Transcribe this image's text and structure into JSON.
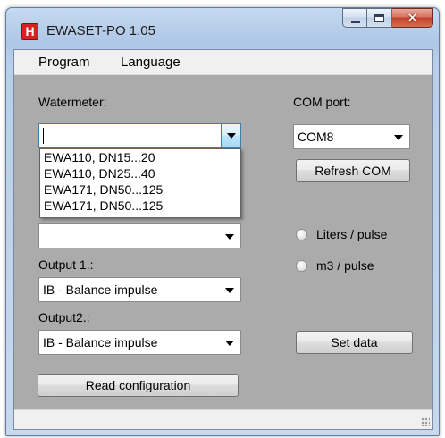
{
  "window": {
    "title": "EWASET-PO 1.05",
    "app_icon_letter": "H"
  },
  "menu": {
    "items": [
      "Program",
      "Language"
    ]
  },
  "watermeter": {
    "label": "Watermeter:",
    "value": "",
    "options": [
      "EWA110, DN15...20",
      "EWA110, DN25...40",
      "EWA171, DN50...125",
      "EWA171, DN50...125"
    ]
  },
  "second_combo": {
    "value": ""
  },
  "output1": {
    "label": "Output 1.:",
    "value": "IB - Balance impulse"
  },
  "output2": {
    "label": "Output2.:",
    "value": "IB - Balance impulse"
  },
  "com": {
    "label": "COM port:",
    "value": "COM8",
    "refresh_label": "Refresh COM"
  },
  "pulse": {
    "liters_label": "Liters / pulse",
    "m3_label": "m3 / pulse",
    "selected": null
  },
  "buttons": {
    "read_config": "Read configuration",
    "set_data": "Set data"
  },
  "colors": {
    "app_icon": "#d91f26",
    "close_button": "#c2412a",
    "client_bg": "#ababab"
  }
}
